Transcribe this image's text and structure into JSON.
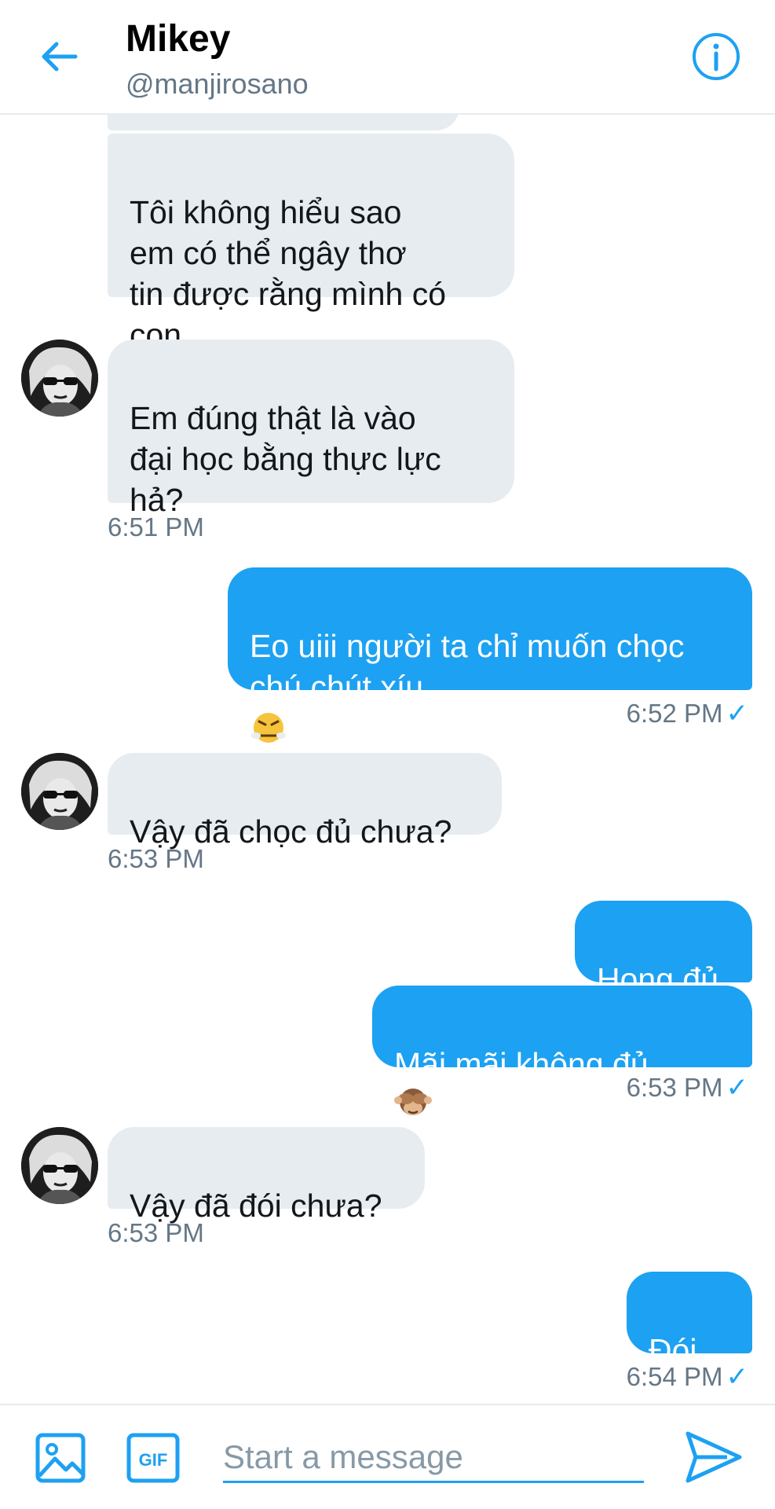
{
  "header": {
    "name": "Mikey",
    "handle": "@manjirosano"
  },
  "messages": [
    {
      "side": "in",
      "text": "Tôi không hiểu sao\nem có thể ngây thơ\ntin được rằng mình có\ncon"
    },
    {
      "side": "in",
      "text": "Em đúng thật là vào\nđại học bằng thực lực\nhả?"
    },
    {
      "side": "time",
      "text": "6:51 PM"
    },
    {
      "side": "out",
      "text": "Eo uiii người ta chỉ muốn chọc\nchú chút xíu",
      "emoji": "angry-face"
    },
    {
      "side": "time",
      "text": "6:52 PM",
      "read": true
    },
    {
      "side": "in",
      "text": "Vậy đã chọc đủ chưa?"
    },
    {
      "side": "time",
      "text": "6:53 PM"
    },
    {
      "side": "out",
      "text": "Hong đủ"
    },
    {
      "side": "out",
      "text": "Mãi mãi không đủ",
      "emoji": "see-no-evil-monkey"
    },
    {
      "side": "time",
      "text": "6:53 PM",
      "read": true
    },
    {
      "side": "in",
      "text": "Vậy đã đói chưa?"
    },
    {
      "side": "time",
      "text": "6:53 PM"
    },
    {
      "side": "out",
      "text": "Đói..."
    },
    {
      "side": "time",
      "text": "6:54 PM",
      "read": true
    }
  ],
  "composer": {
    "placeholder": "Start a message",
    "gif_label": "GIF"
  },
  "colors": {
    "accent": "#1da1f2",
    "incoming_bubble": "#e6ecf0",
    "muted_text": "#657786"
  },
  "icons": {
    "back": "arrow-left-icon",
    "info": "info-icon",
    "media": "image-icon",
    "gif": "gif-icon",
    "send": "send-icon"
  }
}
